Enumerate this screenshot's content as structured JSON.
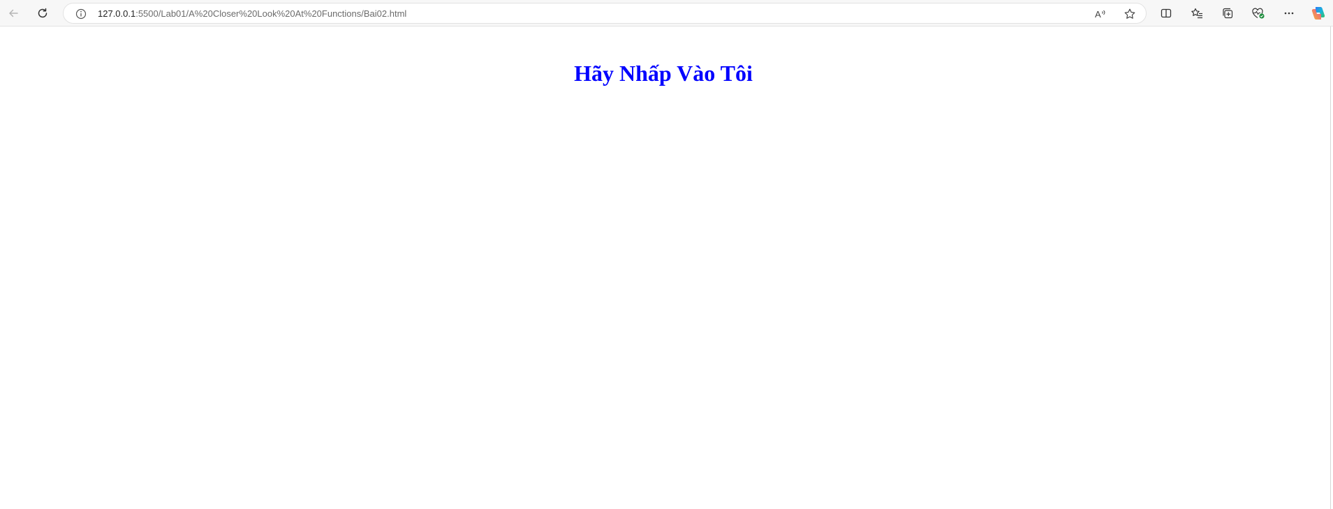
{
  "browser": {
    "url_host": "127.0.0.1",
    "url_path": ":5500/Lab01/A%20Closer%20Look%20At%20Functions/Bai02.html",
    "icons": {
      "back": "back-arrow-icon",
      "refresh": "refresh-icon",
      "site_info": "info-icon",
      "read_aloud": "read-aloud-icon",
      "favorite": "star-icon",
      "split_screen": "split-screen-icon",
      "favorites": "favorites-list-icon",
      "collections": "collections-icon",
      "browser_essentials": "heart-pulse-icon",
      "more": "more-dots-icon",
      "copilot": "copilot-icon"
    }
  },
  "page": {
    "heading": "Hãy Nhấp Vào Tôi",
    "heading_color": "#0000ff"
  }
}
